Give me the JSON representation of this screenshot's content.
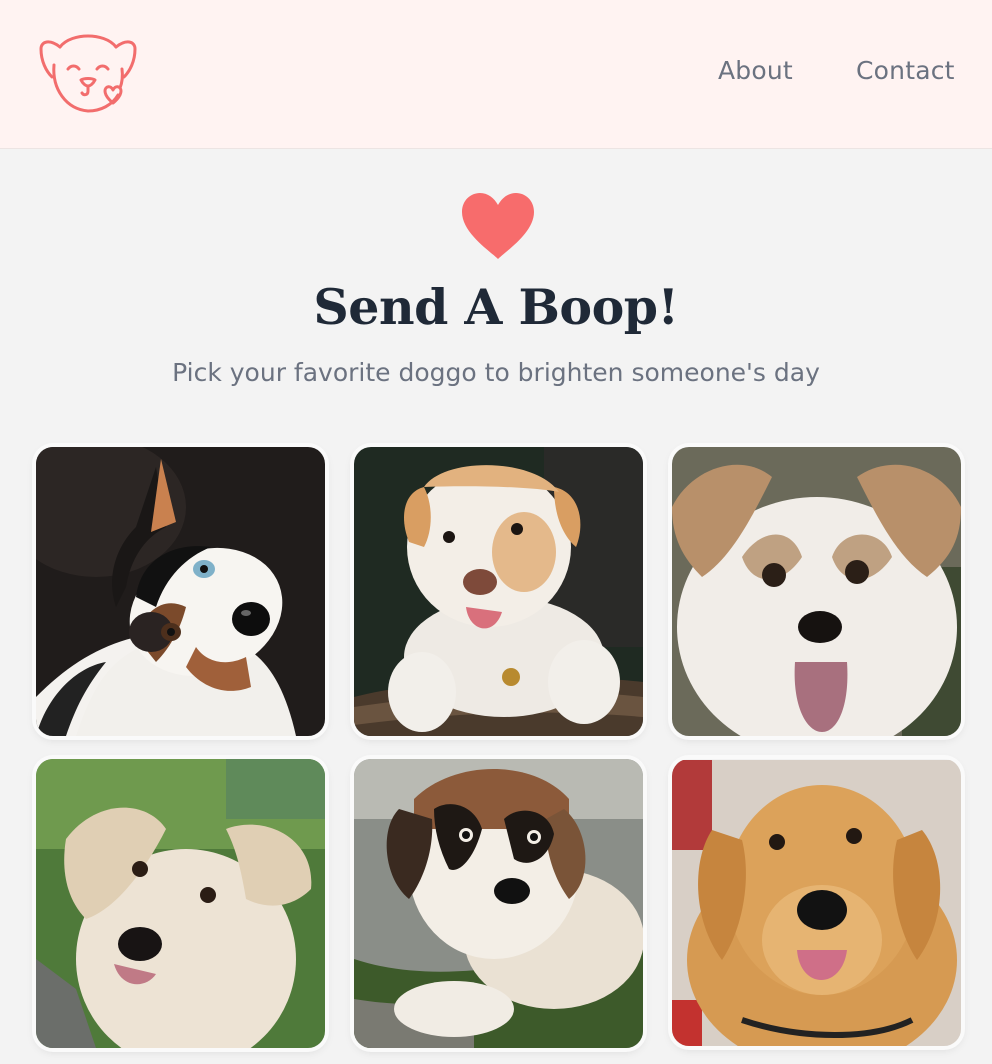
{
  "header": {
    "logo_icon": "dog-face-heart-logo",
    "nav": [
      {
        "label": "About"
      },
      {
        "label": "Contact"
      }
    ]
  },
  "hero": {
    "icon": "heart-icon",
    "title": "Send A Boop!",
    "subtitle": "Pick your favorite doggo to brighten someone's day"
  },
  "colors": {
    "header_bg": "#fff3f2",
    "page_bg": "#f3f3f3",
    "accent": "#f76c6c",
    "title": "#1f2937",
    "muted_text": "#6b7280"
  },
  "dogs": [
    {
      "image": "australian-shepherd-puppy"
    },
    {
      "image": "cream-puppy-on-log"
    },
    {
      "image": "fluffy-small-dog-tongue-out"
    },
    {
      "image": "golden-retriever-puppy"
    },
    {
      "image": "saint-bernard-puppy"
    },
    {
      "image": "golden-retriever"
    }
  ]
}
